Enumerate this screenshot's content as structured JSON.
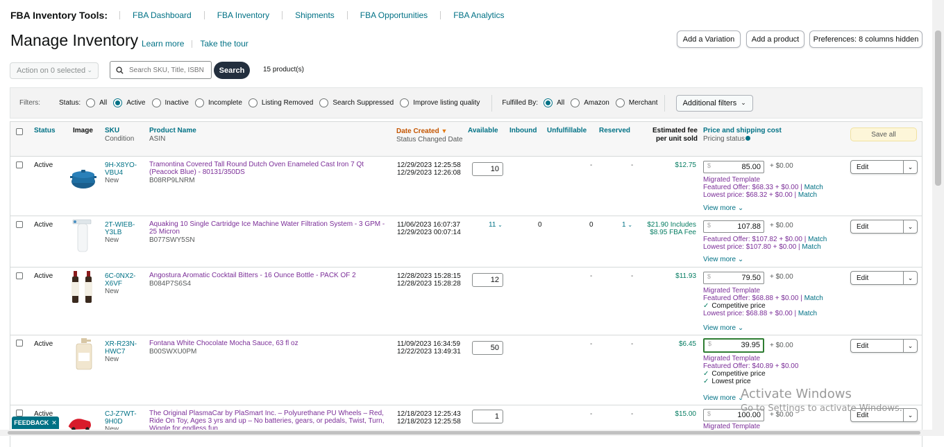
{
  "topnav": {
    "brand": "FBA Inventory Tools:",
    "links": [
      "FBA Dashboard",
      "FBA Inventory",
      "Shipments",
      "FBA Opportunities",
      "FBA Analytics"
    ]
  },
  "header": {
    "title": "Manage Inventory",
    "learn_more": "Learn more",
    "take_tour": "Take the tour",
    "add_variation": "Add a Variation",
    "add_product": "Add a product",
    "preferences": "Preferences: 8 columns hidden"
  },
  "toolbar": {
    "action_select": "Action on 0 selected",
    "search_placeholder": "Search SKU, Title, ISBN, ASIN",
    "search_button": "Search",
    "product_count": "15 product(s)"
  },
  "filters": {
    "label": "Filters:",
    "status_label": "Status:",
    "status_options": [
      "All",
      "Active",
      "Inactive",
      "Incomplete",
      "Listing Removed",
      "Search Suppressed",
      "Improve listing quality"
    ],
    "status_selected": "Active",
    "fulfilled_label": "Fulfilled By:",
    "fulfilled_options": [
      "All",
      "Amazon",
      "Merchant"
    ],
    "fulfilled_selected": "All",
    "additional": "Additional filters"
  },
  "columns": {
    "status": "Status",
    "image": "Image",
    "sku": "SKU",
    "condition": "Condition",
    "product_name": "Product Name",
    "asin": "ASIN",
    "date_created": "Date Created",
    "status_changed": "Status Changed Date",
    "available": "Available",
    "inbound": "Inbound",
    "unfulfillable": "Unfulfillable",
    "reserved": "Reserved",
    "fee": "Estimated fee per unit sold",
    "price": "Price and shipping cost",
    "pricing_status": "Pricing status",
    "save_all": "Save all"
  },
  "rows": [
    {
      "status": "Active",
      "sku1": "9H-X8YO-",
      "sku2": "VBU4",
      "condition": "New",
      "name": "Tramontina Covered Tall Round Dutch Oven Enameled Cast Iron 7 Qt (Peacock Blue) - 80131/350DS",
      "asin": "B08RP9LNRM",
      "created": "12/29/2023 12:25:58",
      "changed": "12/29/2023 12:26:08",
      "available": "10",
      "inbound": "-",
      "unfulfillable": "-",
      "reserved": "-",
      "fee": "$12.75",
      "fee2": "",
      "price": "85.00",
      "shipping": "+ $0.00",
      "info": [
        "Migrated Template",
        "Featured Offer: $68.33 + $0.00",
        "Lowest price: $68.32 + $0.00"
      ],
      "view_more": "View more",
      "edit": "Edit"
    },
    {
      "status": "Active",
      "sku1": "2T-WIEB-",
      "sku2": "Y3LB",
      "condition": "New",
      "name": "Aquaking 10 Single Cartridge Ice Machine Water Filtration System - 3 GPM - 25 Micron",
      "asin": "B077SWY5SN",
      "created": "11/06/2023 16:07:37",
      "changed": "12/29/2023 00:07:14",
      "available": "11",
      "inbound": "0",
      "unfulfillable": "0",
      "reserved": "1",
      "fee": "$21.90 Includes",
      "fee2": "$8.95 FBA Fee",
      "price": "107.88",
      "shipping": "+ $0.00",
      "info": [
        "Featured Offer: $107.82 + $0.00",
        "Lowest price: $107.80 + $0.00"
      ],
      "view_more": "View more",
      "edit": "Edit"
    },
    {
      "status": "Active",
      "sku1": "6C-0NX2-",
      "sku2": "X6VF",
      "condition": "New",
      "name": "Angostura Aromatic Cocktail Bitters - 16 Ounce Bottle - PACK OF 2",
      "asin": "B084P7S6S4",
      "created": "12/28/2023 15:28:15",
      "changed": "12/28/2023 15:28:28",
      "available": "12",
      "inbound": "-",
      "unfulfillable": "-",
      "reserved": "-",
      "fee": "$11.93",
      "fee2": "",
      "price": "79.50",
      "shipping": "+ $0.00",
      "info": [
        "Migrated Template",
        "Featured Offer: $68.88 + $0.00",
        "Competitive price",
        "Lowest price: $68.88 + $0.00"
      ],
      "view_more": "View more",
      "edit": "Edit"
    },
    {
      "status": "Active",
      "sku1": "XR-R23N-",
      "sku2": "HWC7",
      "condition": "New",
      "name": "Fontana White Chocolate Mocha Sauce, 63 fl oz",
      "asin": "B00SWXU0PM",
      "created": "11/09/2023 16:34:59",
      "changed": "12/22/2023 13:49:31",
      "available": "50",
      "inbound": "-",
      "unfulfillable": "-",
      "reserved": "-",
      "fee": "$6.45",
      "fee2": "",
      "price": "39.95",
      "shipping": "+ $0.00",
      "info": [
        "Migrated Template",
        "Featured Offer: $40.89 + $0.00",
        "Competitive price",
        "Lowest price"
      ],
      "view_more": "View more",
      "edit": "Edit"
    },
    {
      "status": "Active",
      "sku1": "CJ-Z7WT-",
      "sku2": "9H0D",
      "condition": "New",
      "name": "The Original PlasmaCar by PlaSmart Inc. – Polyurethane PU Wheels – Red, Ride On Toy, Ages 3 yrs and up – No batteries, gears, or pedals, Twist, Turn, Wiggle for endless fun",
      "asin": "",
      "created": "12/18/2023 12:25:43",
      "changed": "12/18/2023 12:25:58",
      "available": "1",
      "inbound": "-",
      "unfulfillable": "-",
      "reserved": "-",
      "fee": "$15.00",
      "fee2": "",
      "price": "100.00",
      "shipping": "+ $0.00",
      "info": [
        "Migrated Template"
      ],
      "view_more": "",
      "edit": "Edit"
    }
  ],
  "match_label": "Match",
  "overlay": {
    "feedback": "FEEDBACK",
    "watermark_title": "Activate Windows",
    "watermark_sub": "Go to Settings to activate Windows."
  }
}
